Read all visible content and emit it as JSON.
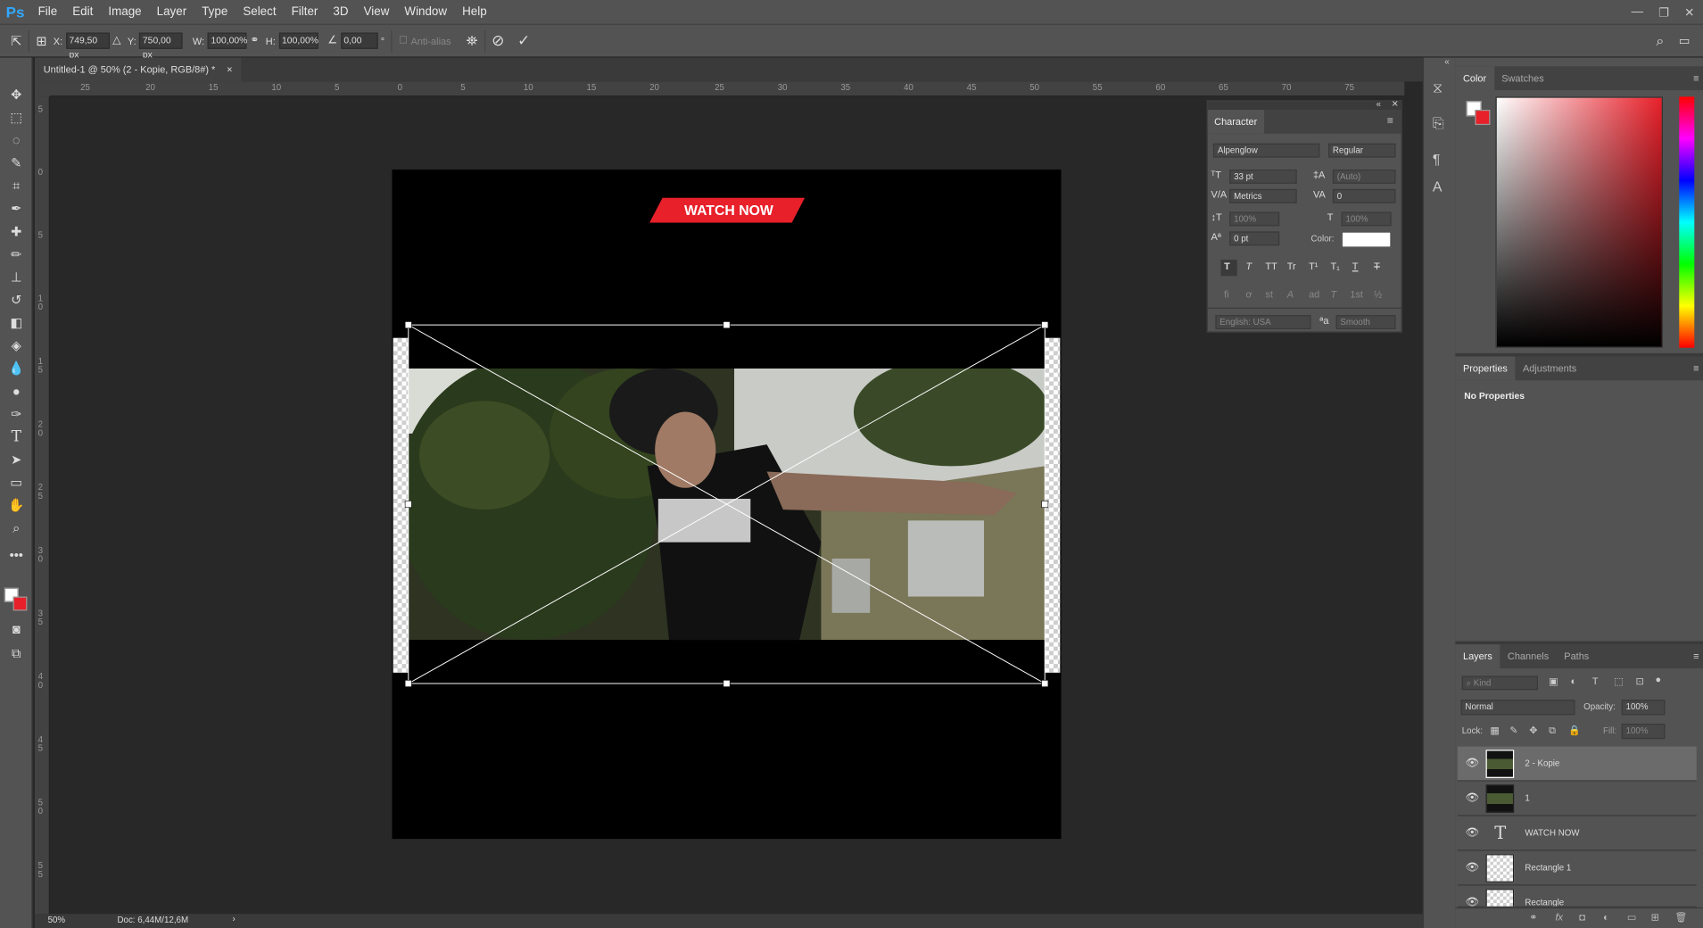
{
  "app": {
    "logo": "Ps"
  },
  "menu": [
    "File",
    "Edit",
    "Image",
    "Layer",
    "Type",
    "Select",
    "Filter",
    "3D",
    "View",
    "Window",
    "Help"
  ],
  "options": {
    "x_label": "X:",
    "x_value": "749,50 px",
    "y_label": "Y:",
    "y_value": "750,00 px",
    "w_label": "W:",
    "w_value": "100,00%",
    "h_label": "H:",
    "h_value": "100,00%",
    "angle_value": "0,00",
    "angle_unit": "°",
    "antialias_label": "Anti-alias"
  },
  "document": {
    "tab_title": "Untitled-1 @ 50% (2 - Kopie, RGB/8#) *",
    "close": "×",
    "banner_text": "WATCH NOW",
    "banner_color": "#e8202a"
  },
  "rulers": {
    "h_ticks": [
      "25",
      "20",
      "15",
      "10",
      "5",
      "0",
      "5",
      "10",
      "15",
      "20",
      "25",
      "30",
      "35",
      "40",
      "45",
      "50",
      "55",
      "60",
      "65",
      "70",
      "75"
    ],
    "v_ticks": [
      "5",
      "0",
      "5",
      "1 0",
      "1 5",
      "2 0",
      "2 5",
      "3 0",
      "3 5",
      "4 0",
      "4 5",
      "5 0",
      "5 5"
    ]
  },
  "status": {
    "zoom": "50%",
    "doc_size": "Doc: 6,44M/12,6M"
  },
  "character": {
    "title": "Character",
    "font_family": "Alpenglow",
    "font_style": "Regular",
    "size": "33 pt",
    "leading": "(Auto)",
    "kerning": "Metrics",
    "tracking": "0",
    "vscale": "100%",
    "hscale": "100%",
    "baseline": "0 pt",
    "color_label": "Color:",
    "language": "English: USA",
    "aa_label": "a",
    "antialias": "Smooth",
    "style_buttons": [
      "T",
      "T",
      "TT",
      "Tr",
      "T¹",
      "T₁",
      "T",
      "T"
    ],
    "opentype_buttons": [
      "fi",
      "ơ",
      "st",
      "A",
      "ad",
      "T",
      "1st",
      "½"
    ]
  },
  "color_panel": {
    "tabs": [
      "Color",
      "Swatches"
    ]
  },
  "properties_panel": {
    "tabs": [
      "Properties",
      "Adjustments"
    ],
    "content": "No Properties"
  },
  "layers_panel": {
    "tabs": [
      "Layers",
      "Channels",
      "Paths"
    ],
    "kind_placeholder": "Kind",
    "blend_mode": "Normal",
    "opacity_label": "Opacity:",
    "opacity_value": "100%",
    "lock_label": "Lock:",
    "fill_label": "Fill:",
    "fill_value": "100%",
    "layers": [
      {
        "name": "2 - Kopie",
        "type": "smart",
        "selected": true
      },
      {
        "name": "1",
        "type": "smart",
        "selected": false
      },
      {
        "name": "WATCH NOW",
        "type": "text",
        "selected": false
      },
      {
        "name": "Rectangle 1",
        "type": "shape",
        "selected": false
      },
      {
        "name": "Rectangle",
        "type": "shape",
        "selected": false
      }
    ]
  }
}
